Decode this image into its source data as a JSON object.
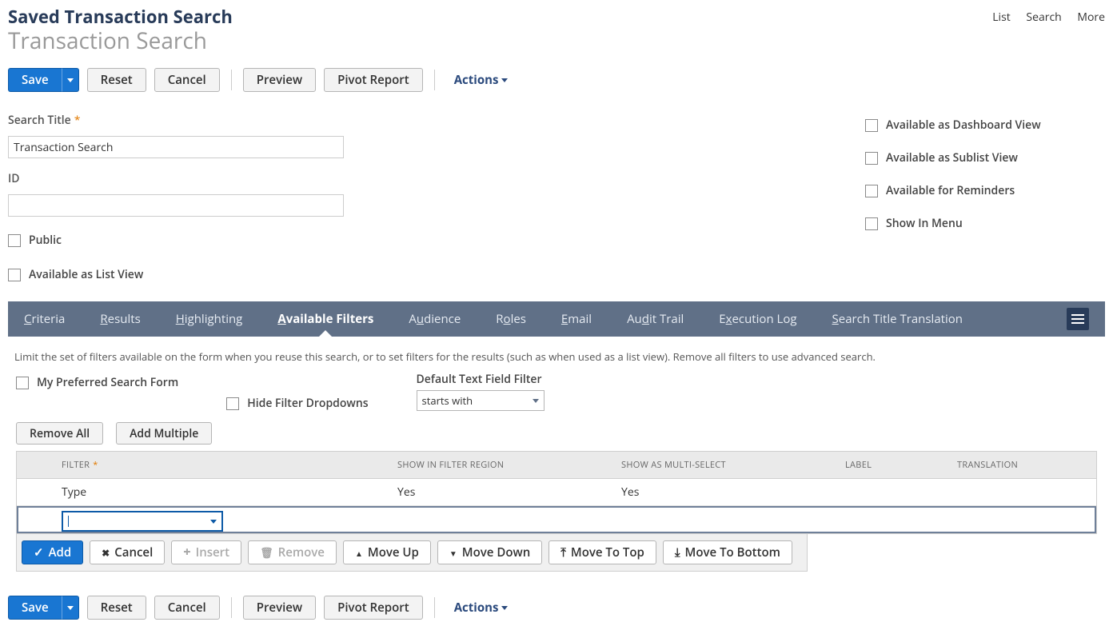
{
  "header": {
    "section": "Saved Transaction Search",
    "title": "Transaction Search",
    "topLinks": {
      "list": "List",
      "search": "Search",
      "more": "More"
    }
  },
  "toolbar": {
    "save": "Save",
    "reset": "Reset",
    "cancel": "Cancel",
    "preview": "Preview",
    "pivot": "Pivot Report",
    "actions": "Actions"
  },
  "form": {
    "searchTitle": {
      "label": "Search Title",
      "value": "Transaction Search"
    },
    "id": {
      "label": "ID",
      "value": ""
    },
    "public": "Public",
    "availListView": "Available as List View",
    "availDashboard": "Available as Dashboard View",
    "availSublist": "Available as Sublist View",
    "availReminders": "Available for Reminders",
    "showInMenu": "Show In Menu"
  },
  "tabs": {
    "criteria": "Criteria",
    "results": "Results",
    "highlighting": "Highlighting",
    "available": "Available Filters",
    "audience": "Audience",
    "roles": "Roles",
    "email": "Email",
    "audit": "Audit Trail",
    "execlog": "Execution Log",
    "titletrans": "Search Title Translation"
  },
  "filters": {
    "helptext": "Limit the set of filters available on the form when you reuse this search, or to set filters for the results (such as when used as a list view). Remove all filters to use advanced search.",
    "myPreferred": "My Preferred Search Form",
    "hideDropdowns": "Hide Filter Dropdowns",
    "defaultTextFilter": {
      "label": "Default Text Field Filter",
      "value": "starts with"
    },
    "removeAll": "Remove All",
    "addMultiple": "Add Multiple",
    "cols": {
      "filter": "FILTER",
      "showRegion": "SHOW IN FILTER REGION",
      "multi": "SHOW AS MULTI-SELECT",
      "label": "LABEL",
      "trans": "TRANSLATION"
    },
    "row0": {
      "filter": "Type",
      "showRegion": "Yes",
      "multi": "Yes",
      "label": "",
      "trans": ""
    },
    "actions": {
      "add": "Add",
      "cancel": "Cancel",
      "insert": "Insert",
      "remove": "Remove",
      "moveup": "Move Up",
      "movedown": "Move Down",
      "movetop": "Move To Top",
      "movebottom": "Move To Bottom"
    }
  }
}
